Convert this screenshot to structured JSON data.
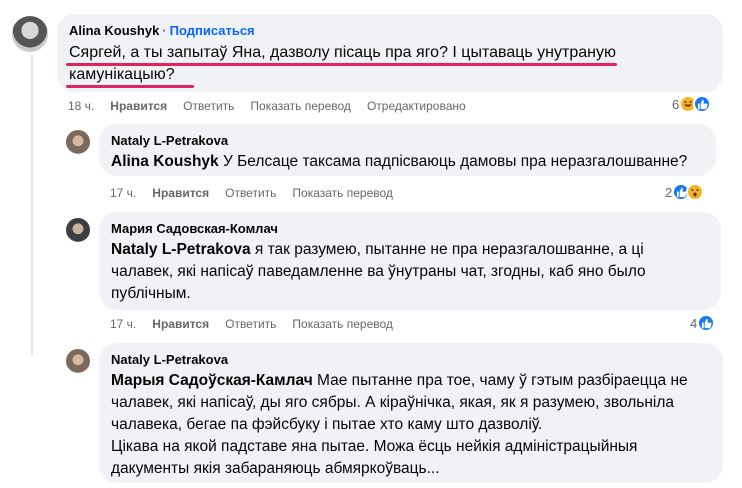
{
  "comments": [
    {
      "author": "Alina Koushyk",
      "follow_label": "Подписаться",
      "text": "Сяргей, а ты запытаў Яна, дазволу пісаць пра яго? І цытаваць унутраную камунікацыю?",
      "time": "18 ч.",
      "like_label": "Нравится",
      "reply_label": "Ответить",
      "translate_label": "Показать перевод",
      "edited_label": "Отредактировано",
      "reaction_count": "6",
      "reactions": [
        "haha-icon",
        "like-icon"
      ]
    },
    {
      "author": "Nataly L-Petrakova",
      "mention": "Alina Koushyk",
      "text": " У Белсаце таксама падпісваюць дамовы пра неразгалошванне?",
      "time": "17 ч.",
      "like_label": "Нравится",
      "reply_label": "Ответить",
      "translate_label": "Показать перевод",
      "reaction_count": "2",
      "reactions": [
        "like-icon",
        "wow-icon"
      ]
    },
    {
      "author": "Мария Садовская-Комлач",
      "mention": "Nataly L-Petrakova",
      "text": " я так разумею, пытанне не пра неразгалошванне, а ці чалавек, які напісаў паведамленне ва ўнутраны чат, згодны, каб яно было публічным.",
      "time": "17 ч.",
      "like_label": "Нравится",
      "reply_label": "Ответить",
      "translate_label": "Показать перевод",
      "reaction_count": "4",
      "reactions": [
        "like-icon"
      ]
    },
    {
      "author": "Nataly L-Petrakova",
      "mention": "Марыя Садоўская-Камлач",
      "text": " Мае пытанне пра тое, чаму ў гэтым разбіраецца не чалавек, які напісаў, ды яго сябры. А кіраўнічка, якая, як я разумею, звольніла чалавека, бегае па фэйсбуку і пытае хто каму што дазволіў.",
      "text2": "Цікава на якой падставе яна пытае. Можа ёсць нейкія адміністрацыйныя дакументы якія забараняюць абмяркоўваць..."
    }
  ],
  "colors": {
    "bubble": "#f0f2f5",
    "follow": "#0866ff",
    "like": "#1877f2",
    "underline": "#e0245e"
  }
}
